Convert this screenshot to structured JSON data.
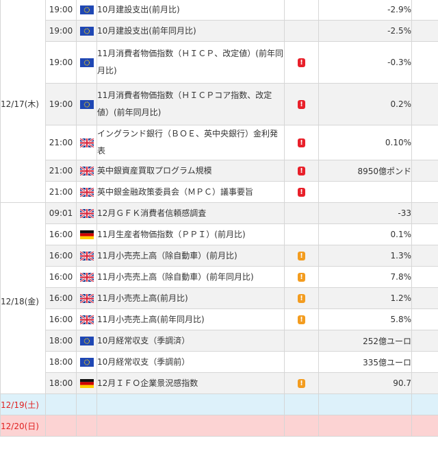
{
  "colors": {
    "high": "#e8202a",
    "mid": "#f39c1f",
    "saturday_bg": "#ddf1fa",
    "sunday_bg": "#fcd3d3",
    "weekend_date_text": "#e02020"
  },
  "importance_glyph": "!",
  "days": [
    {
      "date": "12/17(木)",
      "events": [
        {
          "time": "19:00",
          "flag": "eu-flag-icon",
          "name": "10月建設支出(前月比)",
          "importance": "",
          "value": "-2.9%"
        },
        {
          "time": "19:00",
          "flag": "eu-flag-icon",
          "name": "10月建設支出(前年同月比)",
          "importance": "",
          "value": "-2.5%"
        },
        {
          "time": "19:00",
          "flag": "eu-flag-icon",
          "name": "11月消費者物価指数（ＨＩＣＰ、改定値）(前年同月比)",
          "importance": "high",
          "value": "-0.3%"
        },
        {
          "time": "19:00",
          "flag": "eu-flag-icon",
          "name": "11月消費者物価指数（ＨＩＣＰコア指数、改定値）(前年同月比)",
          "importance": "high",
          "value": "0.2%"
        },
        {
          "time": "21:00",
          "flag": "uk-flag-icon",
          "name": "イングランド銀行（ＢＯＥ、英中央銀行）金利発表",
          "importance": "high",
          "value": "0.10%"
        },
        {
          "time": "21:00",
          "flag": "uk-flag-icon",
          "name": "英中銀資産買取プログラム規模",
          "importance": "high",
          "value": "8950億ポンド"
        },
        {
          "time": "21:00",
          "flag": "uk-flag-icon",
          "name": "英中銀金融政策委員会（ＭＰＣ）議事要旨",
          "importance": "high",
          "value": ""
        }
      ]
    },
    {
      "date": "12/18(金)",
      "events": [
        {
          "time": "09:01",
          "flag": "uk-flag-icon",
          "name": "12月ＧＦＫ消費者信頼感調査",
          "importance": "",
          "value": "-33"
        },
        {
          "time": "16:00",
          "flag": "de-flag-icon",
          "name": "11月生産者物価指数（ＰＰＩ）(前月比)",
          "importance": "",
          "value": "0.1%"
        },
        {
          "time": "16:00",
          "flag": "uk-flag-icon",
          "name": "11月小売売上高（除自動車）(前月比)",
          "importance": "mid",
          "value": "1.3%"
        },
        {
          "time": "16:00",
          "flag": "uk-flag-icon",
          "name": "11月小売売上高（除自動車）(前年同月比)",
          "importance": "mid",
          "value": "7.8%"
        },
        {
          "time": "16:00",
          "flag": "uk-flag-icon",
          "name": "11月小売売上高(前月比)",
          "importance": "mid",
          "value": "1.2%"
        },
        {
          "time": "16:00",
          "flag": "uk-flag-icon",
          "name": "11月小売売上高(前年同月比)",
          "importance": "mid",
          "value": "5.8%"
        },
        {
          "time": "18:00",
          "flag": "eu-flag-icon",
          "name": "10月経常収支（季調済）",
          "importance": "",
          "value": "252億ユーロ"
        },
        {
          "time": "18:00",
          "flag": "eu-flag-icon",
          "name": "10月経常収支（季調前）",
          "importance": "",
          "value": "335億ユーロ"
        },
        {
          "time": "18:00",
          "flag": "de-flag-icon",
          "name": "12月ＩＦＯ企業景況感指数",
          "importance": "mid",
          "value": "90.7"
        }
      ]
    },
    {
      "date": "12/19(土)",
      "kind": "sat",
      "events": []
    },
    {
      "date": "12/20(日)",
      "kind": "sun",
      "events": []
    }
  ]
}
